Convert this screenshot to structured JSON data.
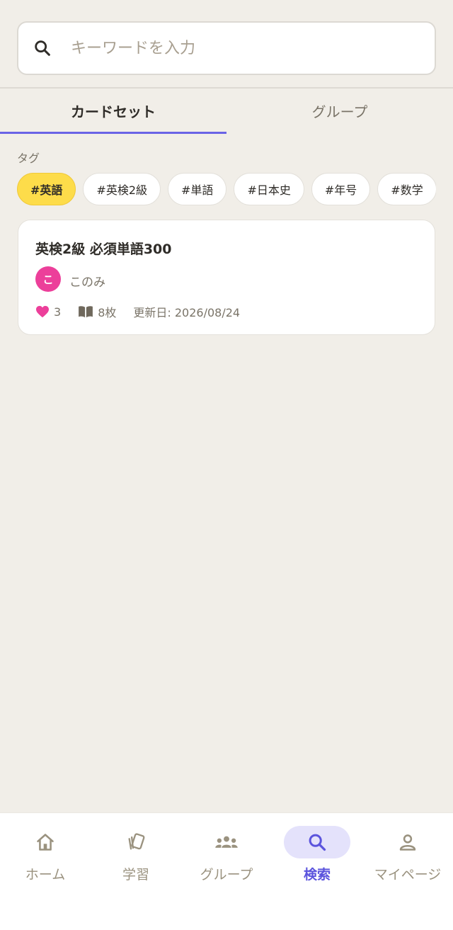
{
  "search": {
    "placeholder": "キーワードを入力",
    "value": ""
  },
  "tabs": [
    {
      "label": "カードセット",
      "active": true
    },
    {
      "label": "グループ",
      "active": false
    }
  ],
  "tag_section": {
    "label": "タグ",
    "tags": [
      "#英語",
      "#英検2級",
      "#単語",
      "#日本史",
      "#年号",
      "#数学"
    ],
    "selected": "#英語"
  },
  "results": [
    {
      "title": "英検2級 必須単語300",
      "author_initial": "こ",
      "author": "このみ",
      "likes": "3",
      "cards": "8枚",
      "updated": "更新日: 2026/08/24"
    }
  ],
  "bottom_nav": [
    {
      "label": "ホーム",
      "icon": "home-icon"
    },
    {
      "label": "学習",
      "icon": "cards-icon"
    },
    {
      "label": "グループ",
      "icon": "group-icon"
    },
    {
      "label": "検索",
      "icon": "search-icon",
      "active": true
    },
    {
      "label": "マイページ",
      "icon": "person-icon"
    }
  ],
  "colors": {
    "background": "#f1eee8",
    "accent": "#6a63e6",
    "tag_active": "#fddc4a",
    "like": "#ec3f9a",
    "avatar": "#ec3f9a"
  }
}
